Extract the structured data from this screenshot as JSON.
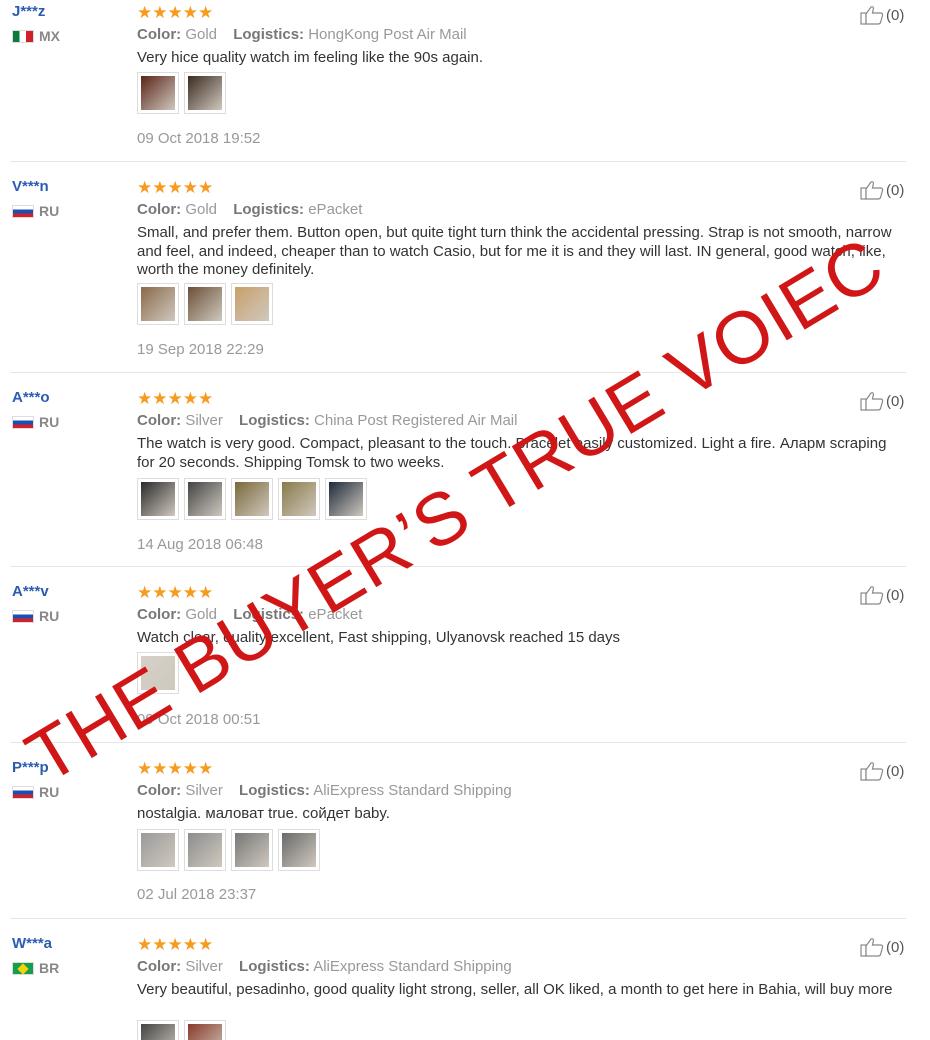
{
  "watermark": "THE BUYER’S TRUE VOIEC",
  "labels": {
    "color": "Color:",
    "logistics": "Logistics:"
  },
  "colors": {
    "stars": "#f79a1e",
    "username": "#2a5db0",
    "watermark": "#d01616"
  },
  "reviews": [
    {
      "user": "J***z",
      "country": "MX",
      "flag": "mx",
      "stars": "★★★★★",
      "color": "Gold",
      "logistics": "HongKong Post Air Mail",
      "text": "Very hice quality watch im feeling like the 90s again.",
      "images": 2,
      "date": "09 Oct 2018 19:52",
      "likes": "(0)"
    },
    {
      "user": "V***n",
      "country": "RU",
      "flag": "ru",
      "stars": "★★★★★",
      "color": "Gold",
      "logistics": "ePacket",
      "text": "Small, and prefer them. Button open, but quite tight turn think the accidental pressing. Strap is not smooth, narrow and feel, and indeed, cheaper than to watch Casio, but for me it is and they will last. IN general, good watch, like, worth the money definitely.",
      "images": 3,
      "date": "19 Sep 2018 22:29",
      "likes": "(0)"
    },
    {
      "user": "A***o",
      "country": "RU",
      "flag": "ru",
      "stars": "★★★★★",
      "color": "Silver",
      "logistics": "China Post Registered Air Mail",
      "text": "The watch is very good. Compact, pleasant to the touch. Bracelet easily customized. Light a fire. Аларм scraping for 20 seconds. Shipping Tomsk to two weeks.",
      "images": 5,
      "date": "14 Aug 2018 06:48",
      "likes": "(0)"
    },
    {
      "user": "A***v",
      "country": "RU",
      "flag": "ru",
      "stars": "★★★★★",
      "color": "Gold",
      "logistics": "ePacket",
      "text": "Watch clear, quality excellent, Fast shipping, Ulyanovsk reached 15 days",
      "images": 1,
      "date": "09 Oct 2018 00:51",
      "likes": "(0)"
    },
    {
      "user": "P***p",
      "country": "RU",
      "flag": "ru",
      "stars": "★★★★★",
      "color": "Silver",
      "logistics": "AliExpress Standard Shipping",
      "text": "nostalgia. маловат true. сойдет baby.",
      "images": 4,
      "date": "02 Jul 2018 23:37",
      "likes": "(0)"
    },
    {
      "user": "W***a",
      "country": "BR",
      "flag": "br",
      "stars": "★★★★★",
      "color": "Silver",
      "logistics": "AliExpress Standard Shipping",
      "text": "Very beautiful, pesadinho, good quality light strong, seller, all OK liked, a month to get here in Bahia, will buy more",
      "images": 2,
      "date": "",
      "likes": "(0)"
    }
  ]
}
